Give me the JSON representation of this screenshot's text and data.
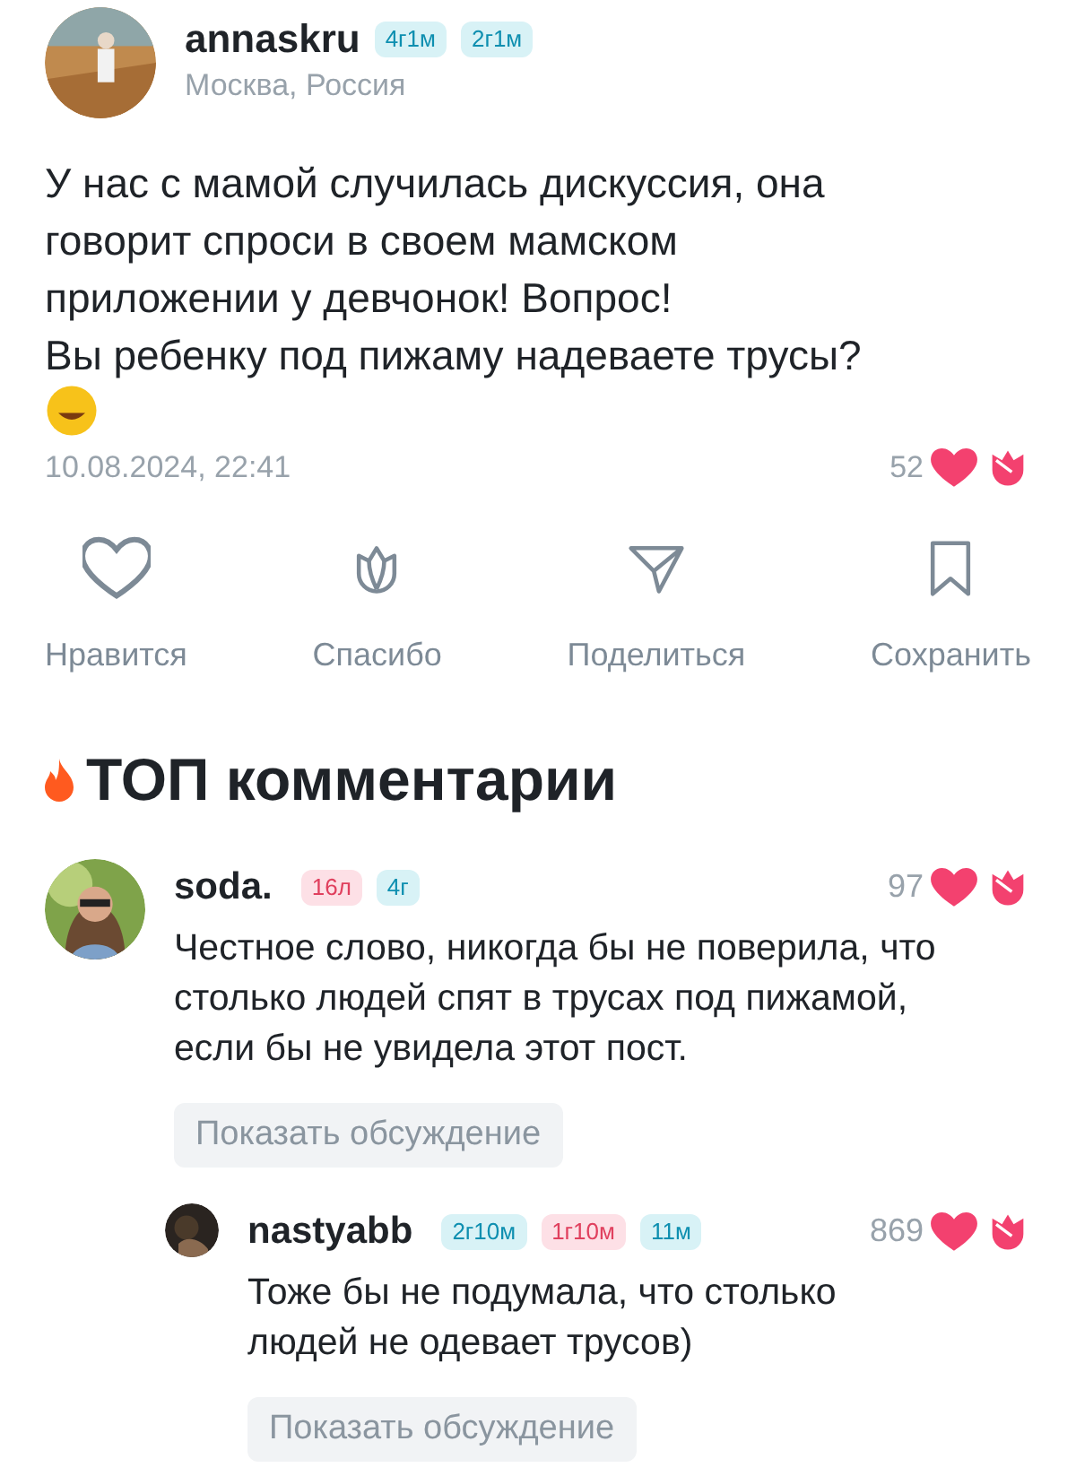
{
  "post": {
    "author": "annaskru",
    "badges": [
      {
        "label": "4г1м",
        "color": "#0e8fb0"
      },
      {
        "label": "2г1м",
        "color": "#0e8fb0"
      }
    ],
    "location": "Москва, Россия",
    "lines": [
      "У нас с мамой случилась дискуссия, она",
      "говорит спроси в своем мамском",
      "приложении у девчонок! Вопрос!",
      "Вы ребенку под пижаму надеваете трусы?"
    ],
    "date": "10.08.2024, 22:41",
    "likes": "52"
  },
  "actions": [
    {
      "kind": "like",
      "label": "Нравится"
    },
    {
      "kind": "thanks",
      "label": "Спасибо"
    },
    {
      "kind": "share",
      "label": "Поделиться"
    },
    {
      "kind": "save",
      "label": "Сохранить"
    }
  ],
  "section_title": "ТОП комментарии",
  "comments": [
    {
      "author": "soda.",
      "badges": [
        {
          "label": "16л",
          "color": "#e0405e"
        },
        {
          "label": "4г",
          "color": "#0e8fb0"
        }
      ],
      "likes": "97",
      "text": "Честное слово, никогда бы не поверила, что столько людей спят в трусах под пижамой, если бы не увидела этот пост.",
      "button": "Показать обсуждение",
      "reply": false
    },
    {
      "author": "nastyabb",
      "badges": [
        {
          "label": "2г10м",
          "color": "#0e8fb0"
        },
        {
          "label": "1г10м",
          "color": "#e0405e"
        },
        {
          "label": "11м",
          "color": "#0e8fb0"
        }
      ],
      "likes": "869",
      "text": "Тоже бы не подумала, что столько людей не одевает трусов)",
      "button": "Показать обсуждение",
      "reply": true
    }
  ]
}
